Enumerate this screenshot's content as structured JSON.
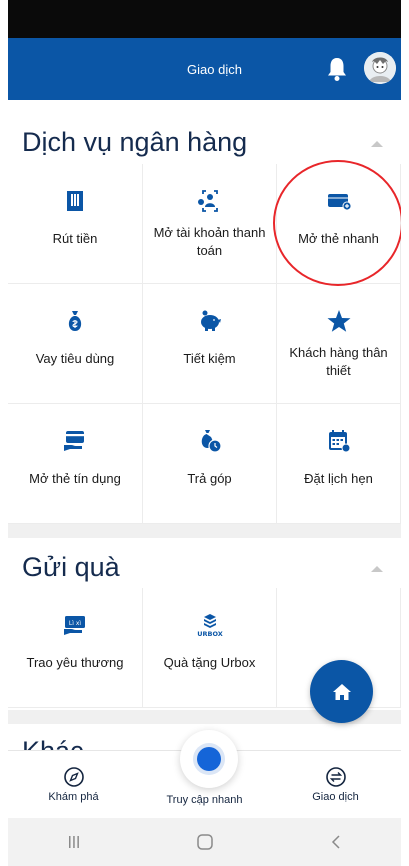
{
  "header": {
    "title": "Giao dịch"
  },
  "banking": {
    "title": "Dịch vụ ngân hàng",
    "items": [
      {
        "label": "Rút tiền"
      },
      {
        "label": "Mở tài khoản thanh toán"
      },
      {
        "label": "Mở thẻ nhanh"
      },
      {
        "label": "Vay tiêu dùng"
      },
      {
        "label": "Tiết kiệm"
      },
      {
        "label": "Khách hàng thân thiết"
      },
      {
        "label": "Mở thẻ tín dụng"
      },
      {
        "label": "Trả góp"
      },
      {
        "label": "Đặt lịch hẹn"
      }
    ]
  },
  "gifts": {
    "title": "Gửi quà",
    "items": [
      {
        "label": "Trao yêu thương",
        "icon_text": "Lì xì"
      },
      {
        "label": "Quà tặng Urbox",
        "icon_text": "URBOX"
      }
    ]
  },
  "next_section": {
    "title": "Khác"
  },
  "bottom_nav": {
    "explore": "Khám phá",
    "quick_access": "Truy cập nhanh",
    "transactions": "Giao dịch"
  },
  "colors": {
    "brand": "#0b56a6",
    "title": "#152b4e",
    "annotation": "#e8262a"
  }
}
